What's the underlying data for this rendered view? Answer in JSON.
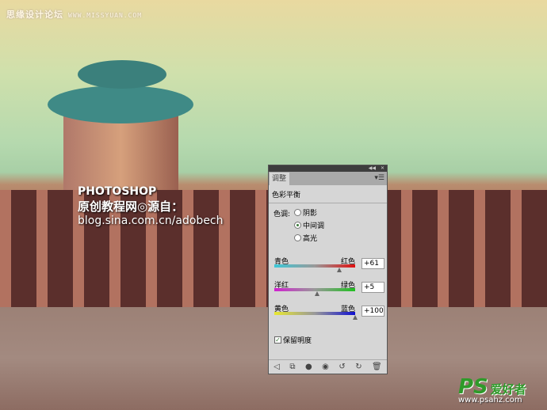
{
  "watermarks": {
    "top_cn": "思缘设计论坛",
    "top_url": "WWW.MISSYUAN.COM",
    "center_line1": "PHOTOSHOP",
    "center_line2": "原创教程网◎源自：",
    "center_line3": "blog.sina.com.cn/adobech",
    "logo_ps": "PS",
    "logo_cn": "爱好者",
    "logo_url": "www.psahz.com"
  },
  "panel": {
    "tab": "调整",
    "adjustment_title": "色彩平衡",
    "tone_label": "色调:",
    "tones": [
      {
        "label": "阴影",
        "selected": false
      },
      {
        "label": "中间调",
        "selected": true
      },
      {
        "label": "高光",
        "selected": false
      }
    ],
    "sliders": [
      {
        "left": "青色",
        "right": "红色",
        "value": "+61",
        "num": 61,
        "from": "#3cc8d8",
        "to": "#e01010"
      },
      {
        "left": "洋红",
        "right": "绿色",
        "value": "+5",
        "num": 5,
        "from": "#d020d0",
        "to": "#20c020"
      },
      {
        "left": "黄色",
        "right": "蓝色",
        "value": "+100",
        "num": 100,
        "from": "#e8e830",
        "to": "#1010d0"
      }
    ],
    "preserve_luminosity": {
      "label": "保留明度",
      "checked": true
    }
  }
}
